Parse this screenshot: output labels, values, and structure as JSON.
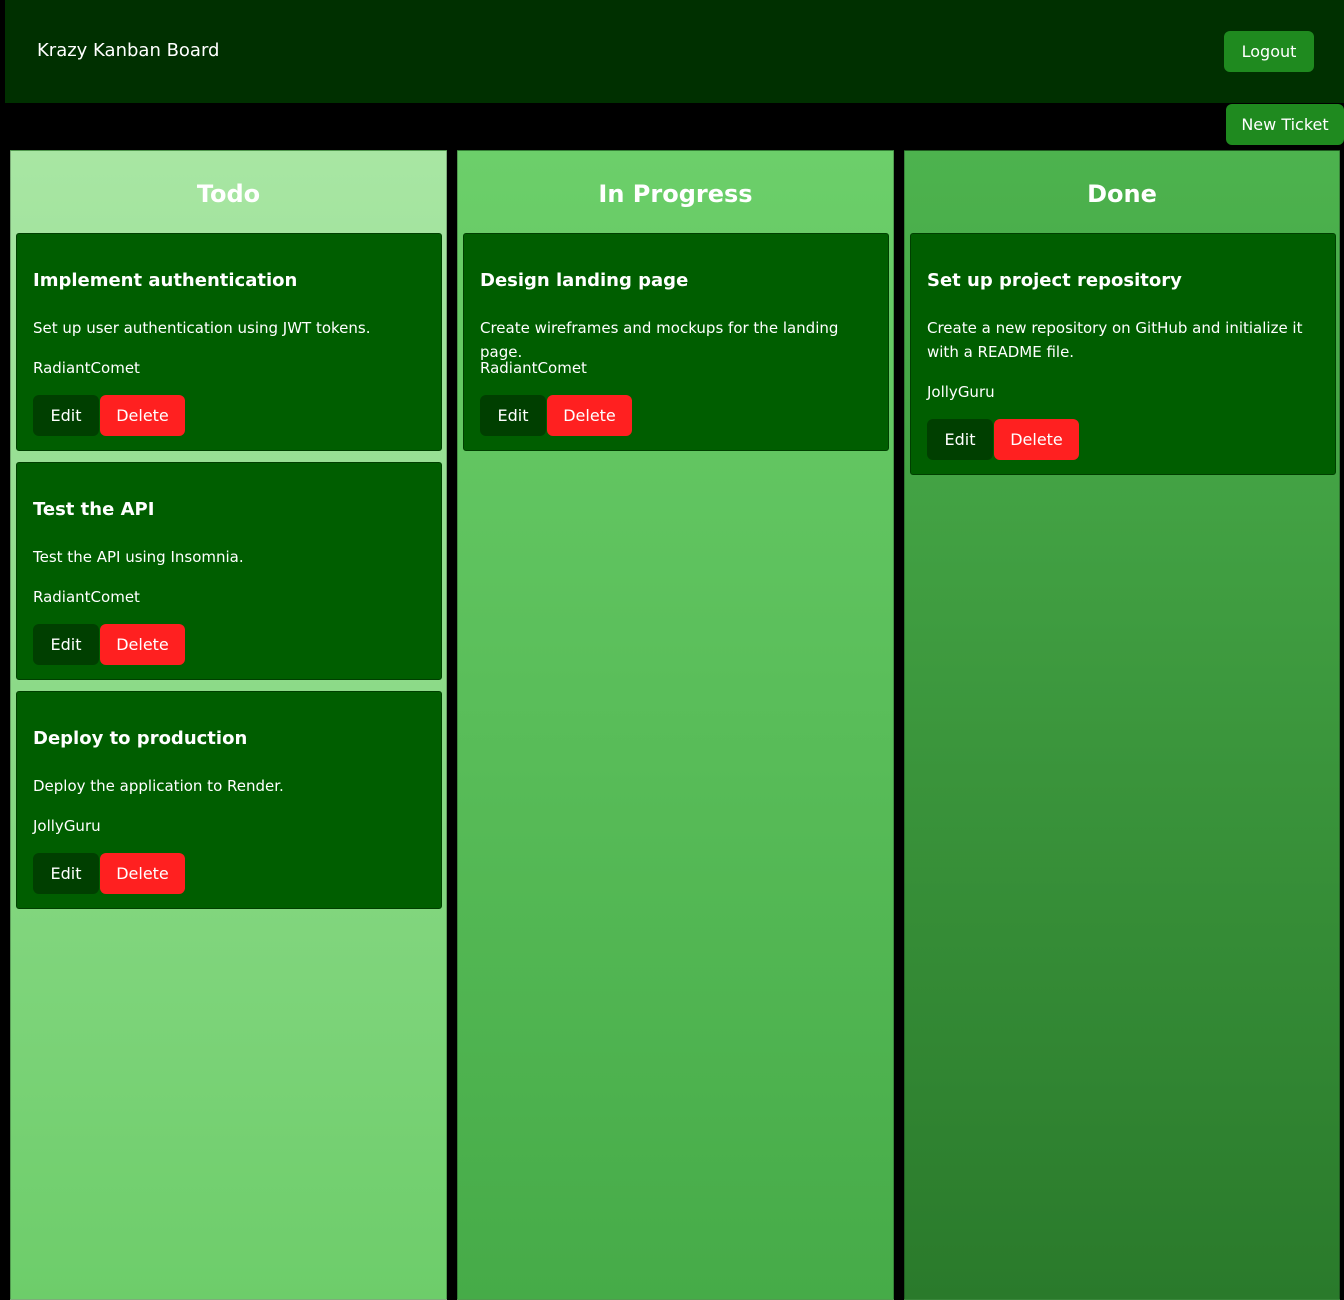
{
  "header": {
    "title": "Krazy Kanban Board",
    "logout_label": "Logout"
  },
  "toolbar": {
    "new_ticket_label": "New Ticket"
  },
  "columns": [
    {
      "title": "Todo",
      "tickets": [
        {
          "title": "Implement authentication",
          "description": "Set up user authentication using JWT tokens.",
          "user": "RadiantComet",
          "edit_label": "Edit",
          "delete_label": "Delete"
        },
        {
          "title": "Test the API",
          "description": "Test the API using Insomnia.",
          "user": "RadiantComet",
          "edit_label": "Edit",
          "delete_label": "Delete"
        },
        {
          "title": "Deploy to production",
          "description": "Deploy the application to Render.",
          "user": "JollyGuru",
          "edit_label": "Edit",
          "delete_label": "Delete"
        }
      ]
    },
    {
      "title": "In Progress",
      "tickets": [
        {
          "title": "Design landing page",
          "description": "Create wireframes and mockups for the landing page.",
          "user": "RadiantComet",
          "edit_label": "Edit",
          "delete_label": "Delete"
        }
      ]
    },
    {
      "title": "Done",
      "tickets": [
        {
          "title": "Set up project repository",
          "description": "Create a new repository on GitHub and initialize it with a README file.",
          "user": "JollyGuru",
          "edit_label": "Edit",
          "delete_label": "Delete"
        }
      ]
    }
  ],
  "colors": {
    "header_bg": "#003000",
    "card_bg": "#005e00",
    "primary_button": "#1f8a1f",
    "delete_button": "#ff2020"
  }
}
